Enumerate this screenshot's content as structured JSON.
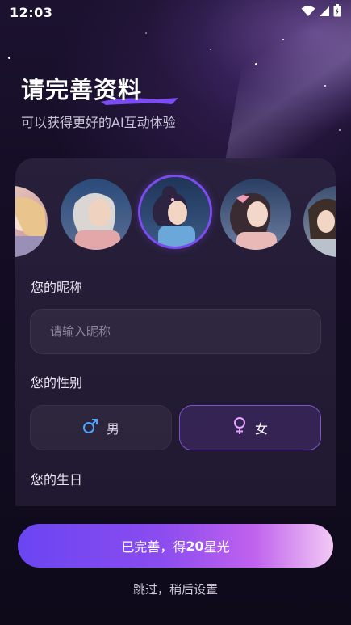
{
  "status_bar": {
    "time": "12:03"
  },
  "header": {
    "title": "请完善资料",
    "subtitle": "可以获得更好的AI互动体验"
  },
  "avatars": {
    "selected_index": 2,
    "items": [
      {
        "name": "avatar-partial-left"
      },
      {
        "name": "avatar-gray-haired-woman"
      },
      {
        "name": "avatar-girl-bun-selected"
      },
      {
        "name": "avatar-girl-pink-bow"
      },
      {
        "name": "avatar-partial-right"
      }
    ]
  },
  "nickname": {
    "label": "您的昵称",
    "placeholder": "请输入昵称",
    "value": ""
  },
  "gender": {
    "label": "您的性别",
    "options": [
      {
        "symbol": "♂",
        "label": "男",
        "selected": false
      },
      {
        "symbol": "♀",
        "label": "女",
        "selected": true
      }
    ]
  },
  "birthday": {
    "label": "您的生日"
  },
  "actions": {
    "primary_prefix": "已完善，得",
    "primary_number": "20",
    "primary_suffix": "星光",
    "skip": "跳过，稍后设置"
  },
  "colors": {
    "accent": "#7d4cf0",
    "male_icon": "#4aa8ff",
    "female_icon": "#e8a2ff"
  }
}
